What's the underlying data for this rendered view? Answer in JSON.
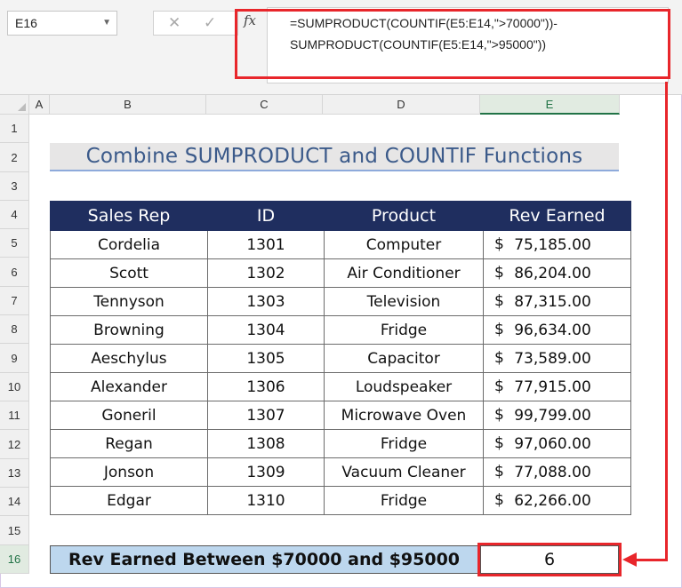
{
  "name_box": "E16",
  "fx_label": "fx",
  "toolbar_icons": [
    "cancel-icon",
    "enter-icon",
    "function-icon"
  ],
  "formula": "=SUMPRODUCT(COUNTIF(E5:E14,\">70000\"))-\nSUMPRODUCT(COUNTIF(E5:E14,\">95000\"))",
  "columns": [
    "A",
    "B",
    "C",
    "D",
    "E"
  ],
  "rows": [
    "1",
    "2",
    "3",
    "4",
    "5",
    "6",
    "7",
    "8",
    "9",
    "10",
    "11",
    "12",
    "13",
    "14",
    "15",
    "16"
  ],
  "title": "Combine SUMPRODUCT and COUNTIF Functions",
  "table": {
    "headers": [
      "Sales Rep",
      "ID",
      "Product",
      "Rev Earned"
    ],
    "rows": [
      {
        "rep": "Cordelia",
        "id": "1301",
        "product": "Computer",
        "cur": "$",
        "rev": "75,185.00"
      },
      {
        "rep": "Scott",
        "id": "1302",
        "product": "Air Conditioner",
        "cur": "$",
        "rev": "86,204.00"
      },
      {
        "rep": "Tennyson",
        "id": "1303",
        "product": "Television",
        "cur": "$",
        "rev": "87,315.00"
      },
      {
        "rep": "Browning",
        "id": "1304",
        "product": "Fridge",
        "cur": "$",
        "rev": "96,634.00"
      },
      {
        "rep": "Aeschylus",
        "id": "1305",
        "product": "Capacitor",
        "cur": "$",
        "rev": "73,589.00"
      },
      {
        "rep": "Alexander",
        "id": "1306",
        "product": "Loudspeaker",
        "cur": "$",
        "rev": "77,915.00"
      },
      {
        "rep": "Goneril",
        "id": "1307",
        "product": "Microwave Oven",
        "cur": "$",
        "rev": "99,799.00"
      },
      {
        "rep": "Regan",
        "id": "1308",
        "product": "Fridge",
        "cur": "$",
        "rev": "97,060.00"
      },
      {
        "rep": "Jonson",
        "id": "1309",
        "product": "Vacuum Cleaner",
        "cur": "$",
        "rev": "77,088.00"
      },
      {
        "rep": "Edgar",
        "id": "1310",
        "product": "Fridge",
        "cur": "$",
        "rev": "62,266.00"
      }
    ]
  },
  "result": {
    "label": "Rev Earned Between $70000 and $95000",
    "value": "6"
  },
  "colors": {
    "header_bg": "#1f2e5f",
    "result_bg": "#bdd7ee",
    "highlight": "#e8262b",
    "title_text": "#3b5a8a"
  }
}
